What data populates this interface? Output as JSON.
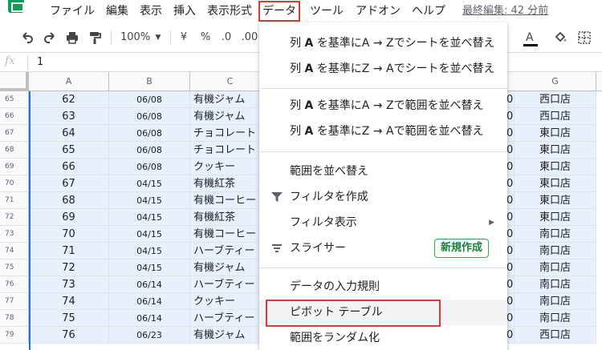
{
  "menubar": {
    "items": [
      "ファイル",
      "編集",
      "表示",
      "挿入",
      "表示形式",
      "データ",
      "ツール",
      "アドオン",
      "ヘルプ"
    ],
    "last_edit": "最終編集: 42 分前"
  },
  "toolbar": {
    "zoom": "100%",
    "currency": "¥",
    "percent": "%",
    "decimal_decrease": ".0",
    "decimal_increase": ".00"
  },
  "formula_bar": {
    "fx": "fx",
    "value": "1"
  },
  "grid": {
    "columns": [
      "A",
      "B",
      "C",
      "G"
    ],
    "rows": [
      {
        "num": "65",
        "a": "62",
        "b": "06/08",
        "c": "有機ジャム",
        "g": "西口店"
      },
      {
        "num": "66",
        "a": "63",
        "b": "06/08",
        "c": "有機ジャム",
        "g": "西口店"
      },
      {
        "num": "67",
        "a": "64",
        "b": "06/08",
        "c": "チョコレート",
        "g": "東口店"
      },
      {
        "num": "68",
        "a": "65",
        "b": "06/08",
        "c": "チョコレート",
        "g": "東口店"
      },
      {
        "num": "69",
        "a": "66",
        "b": "06/08",
        "c": "クッキー",
        "g": "東口店"
      },
      {
        "num": "70",
        "a": "67",
        "b": "04/15",
        "c": "有機紅茶",
        "g": "東口店"
      },
      {
        "num": "71",
        "a": "68",
        "b": "04/15",
        "c": "有機コーヒー",
        "g": "東口店"
      },
      {
        "num": "72",
        "a": "69",
        "b": "04/15",
        "c": "有機紅茶",
        "g": "東口店"
      },
      {
        "num": "73",
        "a": "70",
        "b": "04/15",
        "c": "有機コーヒー",
        "g": "南口店"
      },
      {
        "num": "74",
        "a": "71",
        "b": "04/15",
        "c": "ハーブティー",
        "g": "南口店"
      },
      {
        "num": "75",
        "a": "72",
        "b": "04/15",
        "c": "有機ジャム",
        "g": "南口店"
      },
      {
        "num": "76",
        "a": "73",
        "b": "06/14",
        "c": "ハーブティー",
        "g": "南口店"
      },
      {
        "num": "77",
        "a": "74",
        "b": "06/14",
        "c": "クッキー",
        "g": "南口店"
      },
      {
        "num": "78",
        "a": "75",
        "b": "06/14",
        "c": "ハーブティー",
        "g": "南口店"
      },
      {
        "num": "79",
        "a": "76",
        "b": "06/23",
        "c": "有機ジャム",
        "g": "西口店"
      }
    ],
    "peek_f": "0"
  },
  "data_menu": {
    "sort_sheet_az_pre": "列 ",
    "sort_sheet_az_col": "A",
    "sort_sheet_az_post": " を基準にA → Zでシートを並べ替え",
    "sort_sheet_za_pre": "列 ",
    "sort_sheet_za_col": "A",
    "sort_sheet_za_post": " を基準にZ → Aでシートを並べ替え",
    "sort_range_az_pre": "列 ",
    "sort_range_az_col": "A",
    "sort_range_az_post": " を基準にA → Zで範囲を並べ替え",
    "sort_range_za_pre": "列 ",
    "sort_range_za_col": "A",
    "sort_range_za_post": " を基準にZ → Aで範囲を並べ替え",
    "sort_range": "範囲を並べ替え",
    "create_filter": "フィルタを作成",
    "filter_views": "フィルタ表示",
    "slicer": "スライサー",
    "new_badge": "新規作成",
    "data_validation": "データの入力規則",
    "pivot_table": "ピボット テーブル",
    "randomize_range": "範囲をランダム化"
  },
  "colors": {
    "accent_red": "#e2372b",
    "selection": "#e8f0fe",
    "sheets_green": "#0f9d58",
    "badge_green": "#188038"
  }
}
